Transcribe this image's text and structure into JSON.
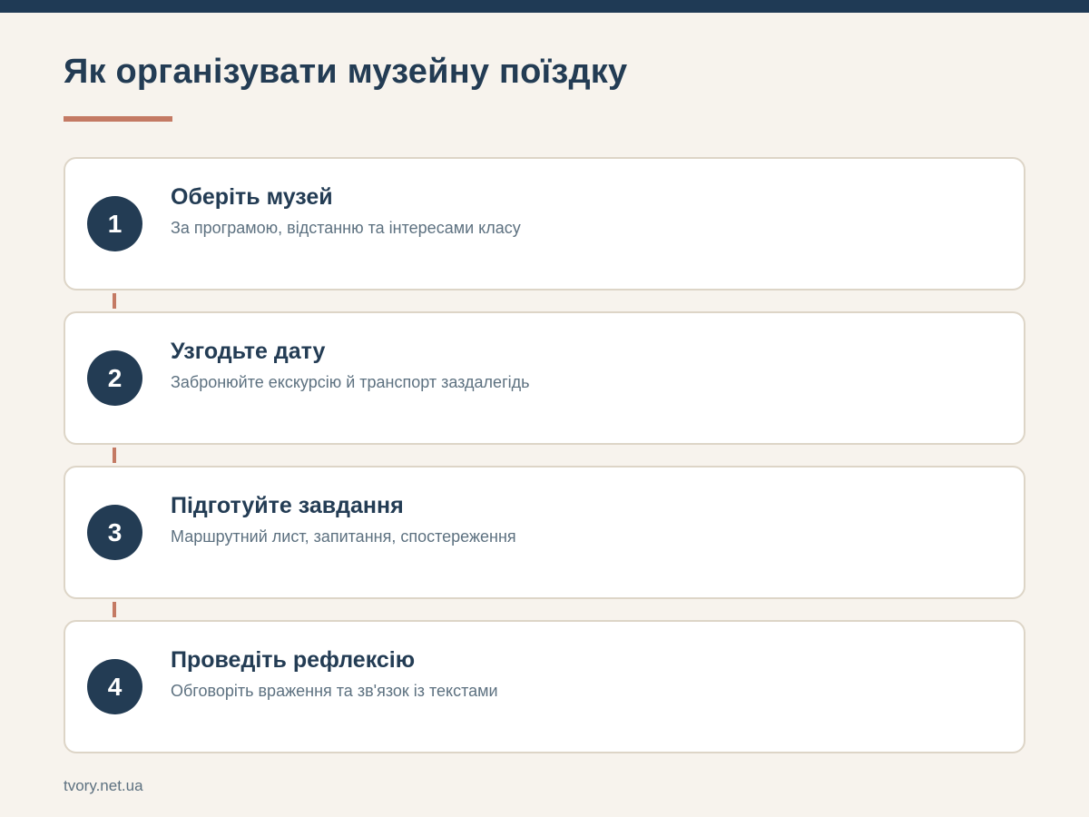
{
  "title": "Як організувати музейну поїздку",
  "accent_color": "#c47a64",
  "primary_color": "#233c54",
  "steps": [
    {
      "number": "1",
      "title": "Оберіть музей",
      "description": "За програмою, відстанню та інтересами класу"
    },
    {
      "number": "2",
      "title": "Узгодьте дату",
      "description": "Забронюйте екскурсію й транспорт заздалегідь"
    },
    {
      "number": "3",
      "title": "Підготуйте завдання",
      "description": "Маршрутний лист, запитання, спостереження"
    },
    {
      "number": "4",
      "title": "Проведіть рефлексію",
      "description": "Обговоріть враження та зв'язок із текстами"
    }
  ],
  "footer": "tvory.net.ua"
}
